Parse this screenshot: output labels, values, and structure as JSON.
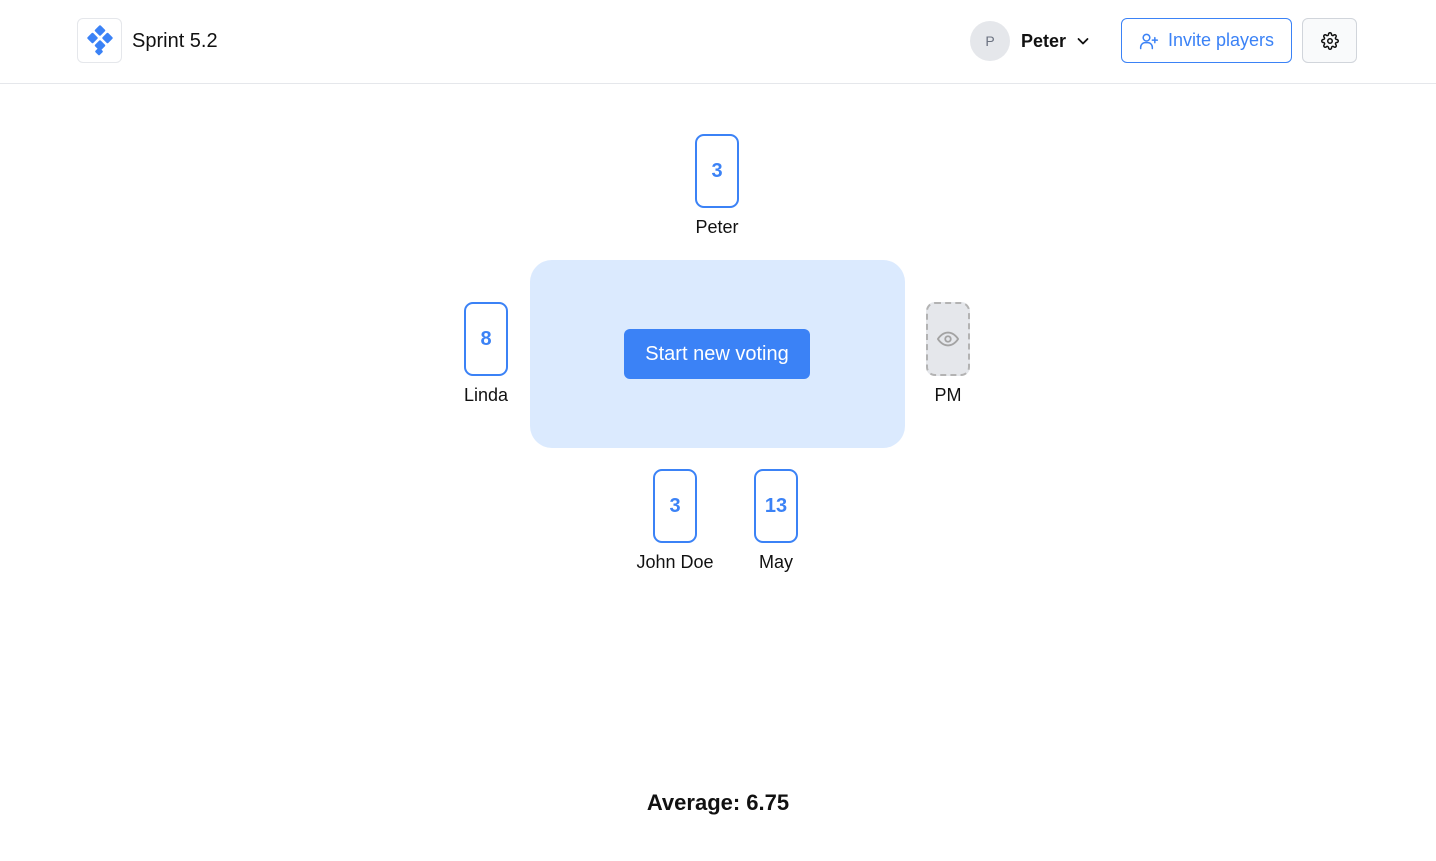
{
  "header": {
    "title": "Sprint 5.2",
    "user": {
      "initial": "P",
      "name": "Peter"
    },
    "invite_label": "Invite players",
    "icons": {
      "logo": "logo-icon",
      "chevron": "chevron-down-icon",
      "invite": "user-plus-icon",
      "settings": "gear-icon"
    }
  },
  "table": {
    "start_label": "Start new voting"
  },
  "players": {
    "peter": {
      "name": "Peter",
      "vote": "3"
    },
    "linda": {
      "name": "Linda",
      "vote": "8"
    },
    "pm": {
      "name": "PM",
      "vote": "",
      "spectator": true
    },
    "john": {
      "name": "John Doe",
      "vote": "3"
    },
    "may": {
      "name": "May",
      "vote": "13"
    }
  },
  "average": "Average: 6.75",
  "colors": {
    "accent": "#3b82f6",
    "table": "#dbeafe",
    "border": "#e5e7eb"
  }
}
